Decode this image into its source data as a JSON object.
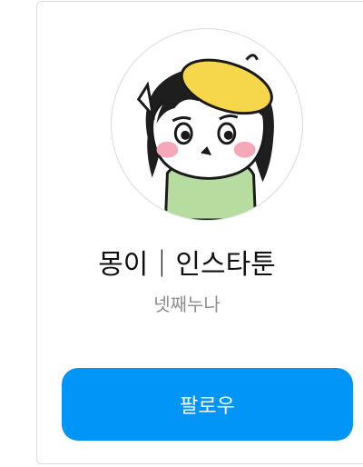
{
  "profile": {
    "name": "몽이｜인스타툰",
    "subtitle": "넷째누나",
    "avatar_icon": "cartoon-girl-yellow-beret-avatar"
  },
  "actions": {
    "follow_label": "팔로우"
  },
  "colors": {
    "accent": "#0095f6",
    "card_border": "#dbdbdb",
    "subtitle_text": "#8e8e8e",
    "title_text": "#111111"
  }
}
